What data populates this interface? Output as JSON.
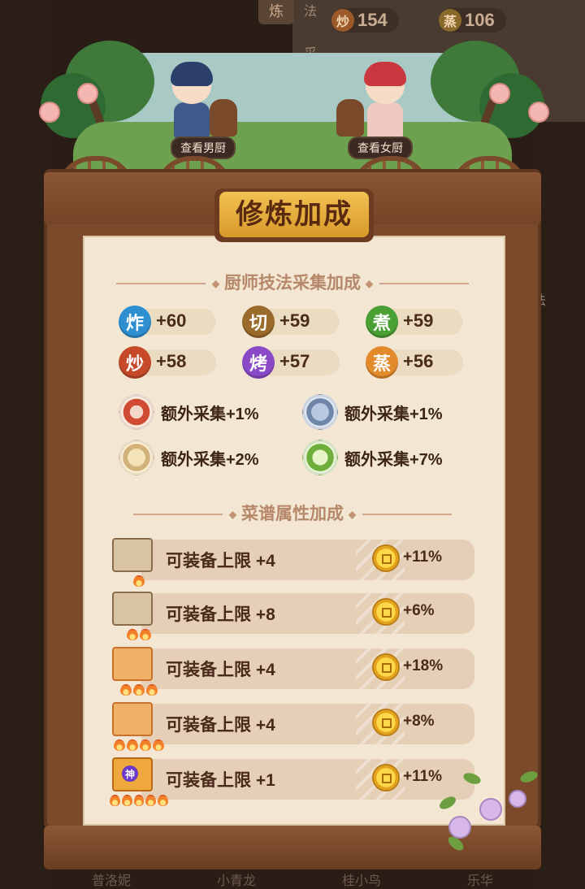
{
  "background": {
    "tab_label": "炼",
    "side_labels": [
      "法",
      "采"
    ],
    "right_label": "法",
    "stats": [
      {
        "icon": "炒",
        "value": "154",
        "color": "#9c5a2a"
      },
      {
        "icon": "蒸",
        "value": "106",
        "color": "#8a6a2a"
      }
    ],
    "bottom_names": [
      "普洛妮",
      "小青龙",
      "桂小鸟",
      "乐华"
    ]
  },
  "header": {
    "view_male_chef": "查看男厨",
    "view_female_chef": "查看女厨"
  },
  "title": "修炼加成",
  "skills_section": {
    "title": "厨师技法采集加成",
    "skills": [
      {
        "icon": "炸",
        "value": "+60",
        "color": "#2d8fd0"
      },
      {
        "icon": "切",
        "value": "+59",
        "color": "#9a6a2a"
      },
      {
        "icon": "煮",
        "value": "+59",
        "color": "#4aa034"
      },
      {
        "icon": "炒",
        "value": "+58",
        "color": "#c64a2a"
      },
      {
        "icon": "烤",
        "value": "+57",
        "color": "#8a4ac8"
      },
      {
        "icon": "蒸",
        "value": "+56",
        "color": "#e38a2a"
      }
    ],
    "extras": [
      {
        "icon": "meat-icon",
        "text": "额外采集+1%"
      },
      {
        "icon": "fish-icon",
        "text": "额外采集+1%"
      },
      {
        "icon": "flour-icon",
        "text": "额外采集+2%"
      },
      {
        "icon": "cabbage-icon",
        "text": "额外采集+7%"
      }
    ]
  },
  "recipe_section": {
    "title": "菜谱属性加成",
    "rows": [
      {
        "label": "可装备上限 +4",
        "bonus": "+11%",
        "fires": 1,
        "tier": "plain"
      },
      {
        "label": "可装备上限 +8",
        "bonus": "+6%",
        "fires": 2,
        "tier": "plain"
      },
      {
        "label": "可装备上限 +4",
        "bonus": "+18%",
        "fires": 3,
        "tier": "orange"
      },
      {
        "label": "可装备上限 +4",
        "bonus": "+8%",
        "fires": 4,
        "tier": "orange"
      },
      {
        "label": "可装备上限 +1",
        "bonus": "+11%",
        "fires": 5,
        "tier": "gold",
        "badge": "神"
      }
    ]
  }
}
